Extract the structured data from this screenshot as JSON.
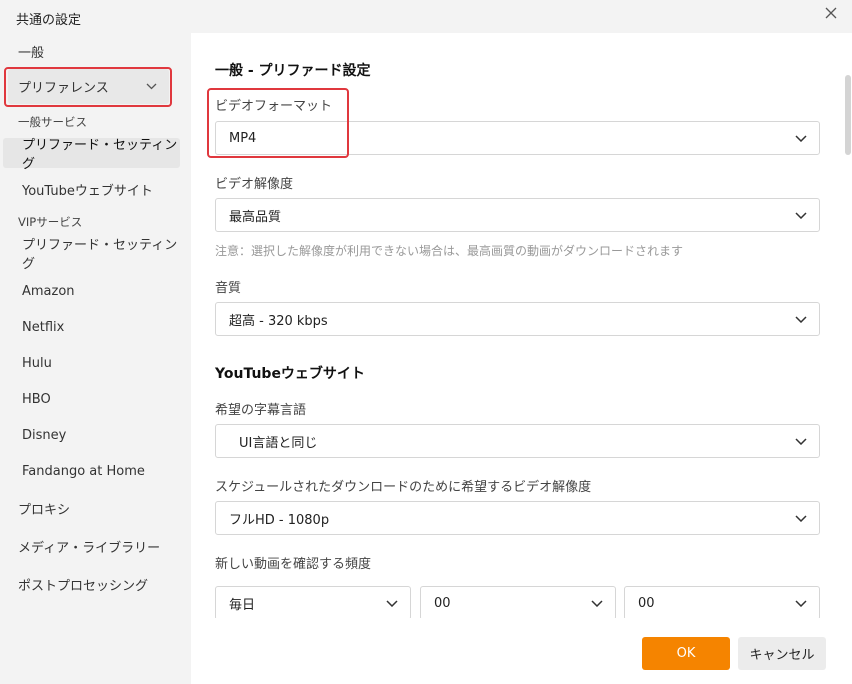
{
  "window": {
    "title": "共通の設定"
  },
  "sidebar": {
    "general": "一般",
    "group_label": "プリファレンス",
    "general_services_header": "一般サービス",
    "general_items": [
      "プリファード・セッティング",
      "YouTubeウェブサイト"
    ],
    "vip_header": "VIPサービス",
    "vip_items": [
      "プリファード・セッティング",
      "Amazon",
      "Netflix",
      "Hulu",
      "HBO",
      "Disney",
      "Fandango at Home"
    ],
    "bottom_items": [
      "プロキシ",
      "メディア・ライブラリー",
      "ポストプロセッシング"
    ]
  },
  "main": {
    "section1_title": "一般 - プリファード設定",
    "video_format": {
      "label": "ビデオフォーマット",
      "value": "MP4"
    },
    "video_resolution": {
      "label": "ビデオ解像度",
      "value": "最高品質"
    },
    "resolution_note": "注意：選択した解像度が利用できない場合は、最高画質の動画がダウンロードされます",
    "audio_quality": {
      "label": "音質",
      "value": "超高 - 320 kbps"
    },
    "section2_title": "YouTubeウェブサイト",
    "subtitle_language": {
      "label": "希望の字幕言語",
      "value": "UI言語と同じ"
    },
    "scheduled_resolution": {
      "label": "スケジュールされたダウンロードのために希望するビデオ解像度",
      "value": "フルHD - 1080p"
    },
    "check_frequency": {
      "label": "新しい動画を確認する頻度",
      "values": [
        "毎日",
        "00",
        "00"
      ]
    }
  },
  "footer": {
    "ok_label": "OK",
    "cancel_label": "キャンセル"
  },
  "colors": {
    "accent": "#f58400",
    "highlight": "#e0383e",
    "sidebar_bg": "#f3f3f3"
  }
}
